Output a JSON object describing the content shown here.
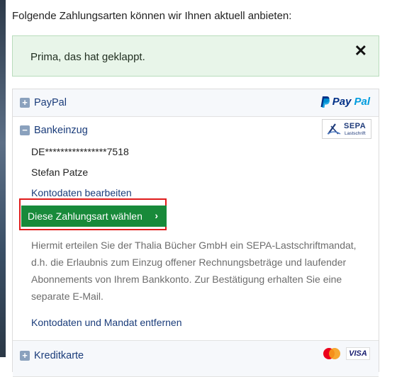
{
  "intro_text": "Folgende Zahlungsarten können wir Ihnen aktuell anbieten:",
  "alert": {
    "message": "Prima, das hat geklappt.",
    "close_symbol": "✕"
  },
  "methods": {
    "paypal": {
      "label": "PayPal",
      "toggle_symbol": "+",
      "logo_pay": "Pay",
      "logo_pal": "Pal"
    },
    "bankeinzug": {
      "label": "Bankeinzug",
      "toggle_symbol": "−",
      "badge_title": "SEPA",
      "badge_sub": "Lastschrift",
      "iban": "DE****************7518",
      "holder": "Stefan Patze",
      "edit_link": "Kontodaten bearbeiten",
      "choose_button": "Diese Zahlungsart wählen",
      "choose_chevron": "›",
      "mandate_text": "Hiermit erteilen Sie der Thalia Bücher GmbH ein SEPA-Lastschriftmandat, d.h. die Erlaubnis zum Einzug offener Rechnungsbeträge und laufender Abonnements von Ihrem Bankkonto. Zur Bestätigung erhalten Sie eine separate E-Mail.",
      "remove_link": "Kontodaten und Mandat entfernen"
    },
    "kreditkarte": {
      "label": "Kreditkarte",
      "toggle_symbol": "+",
      "visa_label": "VISA"
    }
  },
  "colors": {
    "accent_green": "#188a3a",
    "highlight_red": "#e01b1b",
    "link_blue": "#1a3c7a",
    "paypal_dark": "#003087",
    "paypal_light": "#009cde"
  },
  "icons": [
    "close-icon",
    "plus-icon",
    "minus-icon",
    "chevron-right-icon",
    "paypal-logo",
    "sepa-logo",
    "mastercard-logo",
    "visa-logo"
  ]
}
